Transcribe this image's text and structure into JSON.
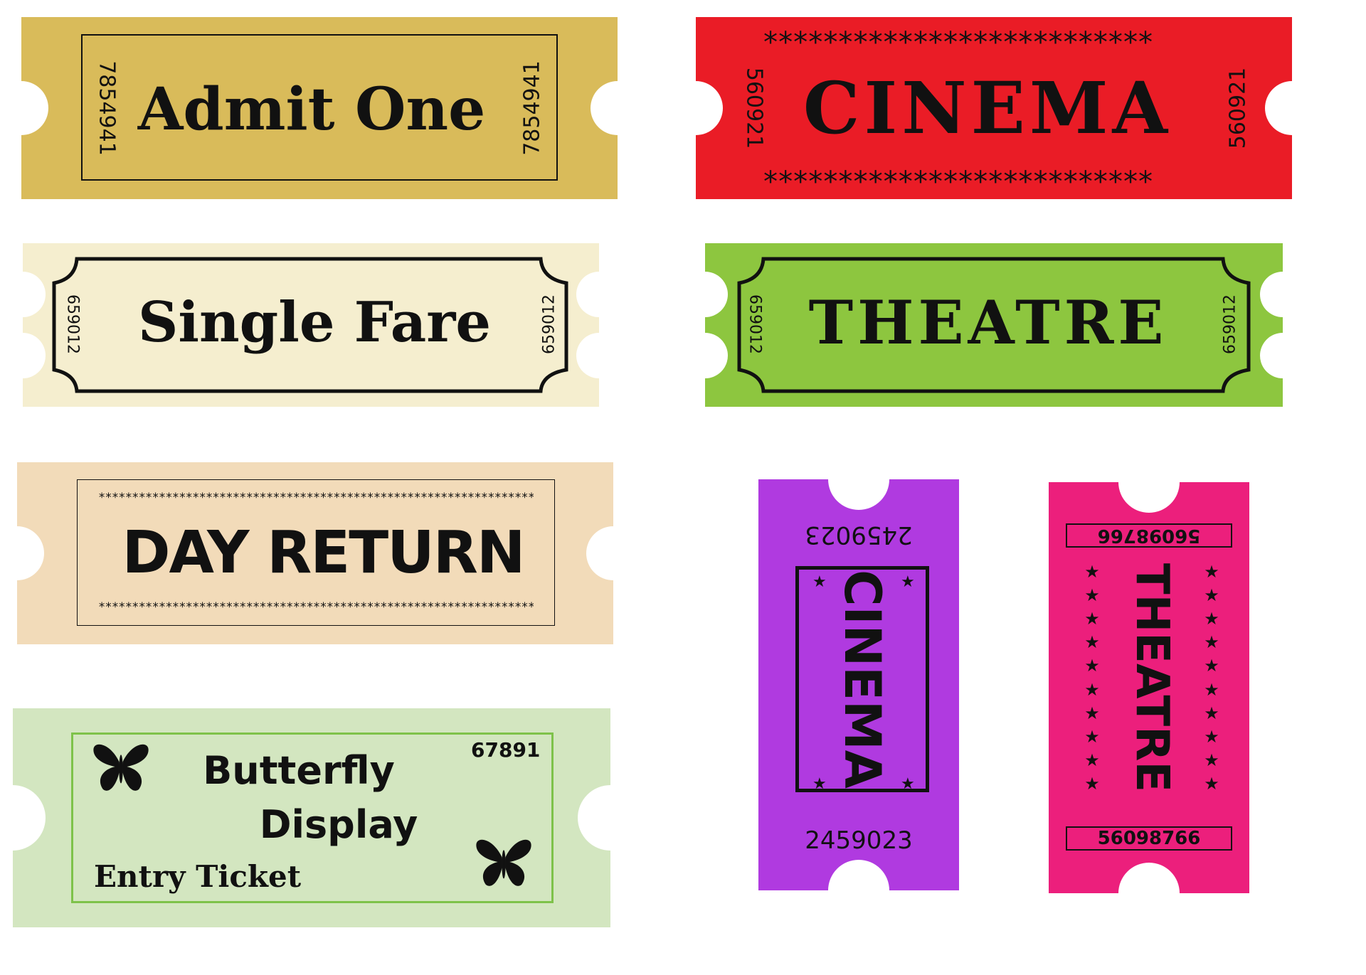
{
  "colors": {
    "admit_one": "#d9bb5a",
    "cinema_red": "#ea1c26",
    "single_fare": "#f5eecf",
    "theatre_green": "#8dc63f",
    "day_return": "#f2dbb9",
    "butterfly": "#d3e6c0",
    "butterfly_frame": "#7ec24a",
    "cinema_purple": "#b03ae0",
    "theatre_pink": "#ec1f7c"
  },
  "tickets": {
    "admit_one": {
      "title": "Admit One",
      "number_left": "7854941",
      "number_right": "7854941"
    },
    "cinema_red": {
      "title": "CINEMA",
      "stars_top": "**************************",
      "stars_bottom": "**************************",
      "number_left": "560921",
      "number_right": "560921"
    },
    "single_fare": {
      "title": "Single Fare",
      "number_left": "659012",
      "number_right": "659012"
    },
    "theatre_green": {
      "title": "THEATRE",
      "number_left": "659012",
      "number_right": "659012"
    },
    "day_return": {
      "title": "DAY RETURN",
      "stars_top": "*****************************************************************",
      "stars_bottom": "*****************************************************************"
    },
    "butterfly": {
      "title_line1": "Butterfly",
      "title_line2": "Display",
      "subtitle": "Entry Ticket",
      "number": "67891",
      "icon": "butterfly-icon"
    },
    "cinema_purple": {
      "title": "CINEMA",
      "number_top": "2459023",
      "number_bottom": "2459023",
      "icon": "star-icon"
    },
    "theatre_pink": {
      "title": "THEATRE",
      "number_top": "56098766",
      "number_bottom": "56098766",
      "icon": "star-icon"
    }
  }
}
